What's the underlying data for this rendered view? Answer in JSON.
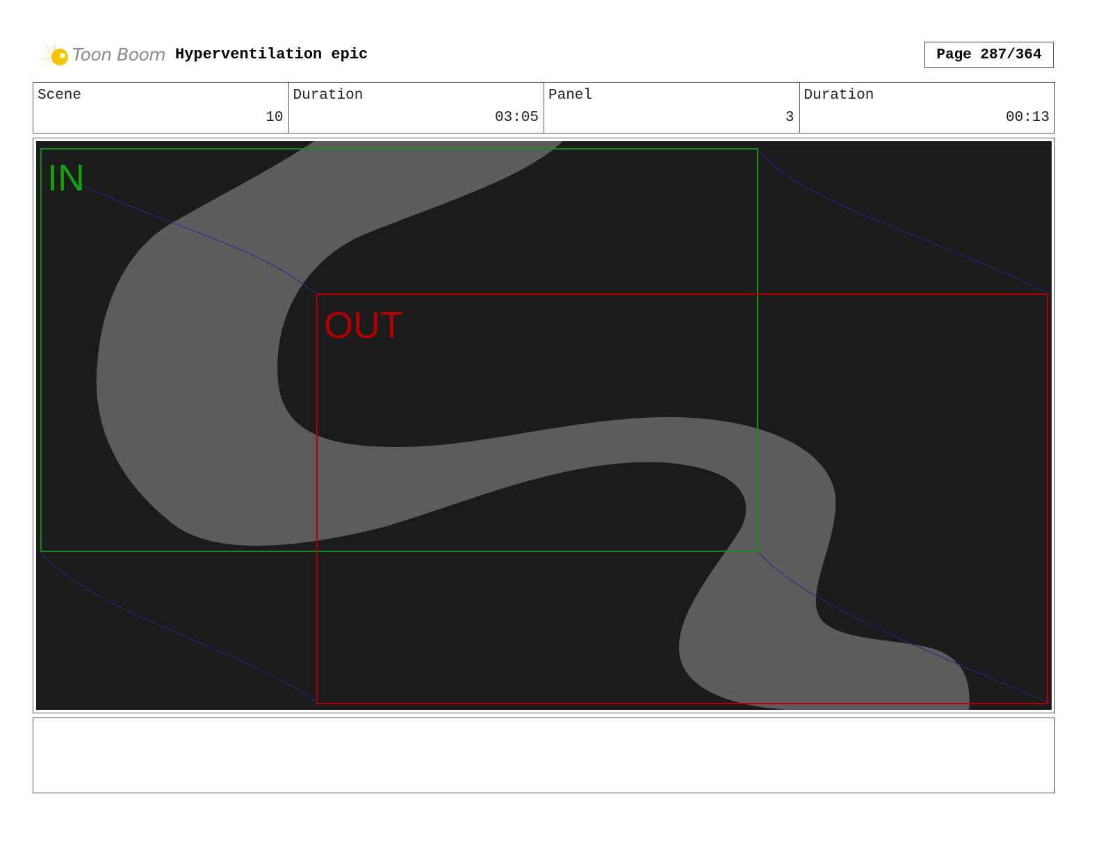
{
  "header": {
    "logo_text": "Toon Boom",
    "project_title": "Hyperventilation epic",
    "page": "Page 287/364"
  },
  "info": {
    "scene_label": "Scene",
    "scene_value": "10",
    "scene_duration_label": "Duration",
    "scene_duration_value": "03:05",
    "panel_label": "Panel",
    "panel_value": "3",
    "panel_duration_label": "Duration",
    "panel_duration_value": "00:13"
  },
  "panel": {
    "in_label": "IN",
    "out_label": "OUT",
    "in_color": "#10a010",
    "out_color": "#b00000",
    "background_color": "#1b1b1b",
    "road_color": "#5c5c5c"
  },
  "notes": {
    "text": ""
  }
}
